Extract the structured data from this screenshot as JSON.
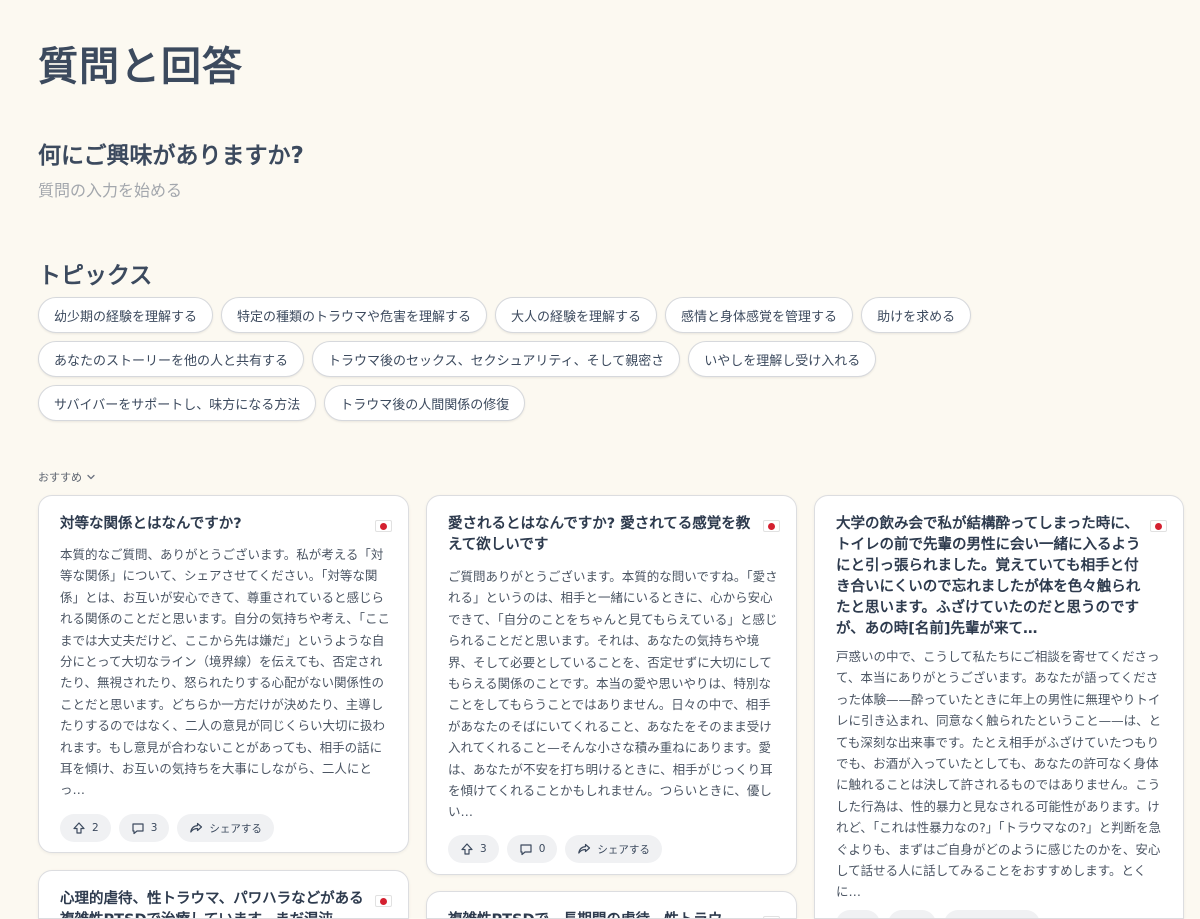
{
  "page_title": "質問と回答",
  "question": {
    "heading": "何にご興味がありますか?",
    "placeholder": "質問の入力を始める"
  },
  "topics": {
    "heading": "トピックス",
    "items": [
      "幼少期の経験を理解する",
      "特定の種類のトラウマや危害を理解する",
      "大人の経験を理解する",
      "感情と身体感覚を管理する",
      "助けを求める",
      "あなたのストーリーを他の人と共有する",
      "トラウマ後のセックス、セクシュアリティ、そして親密さ",
      "いやしを理解し受け入れる",
      "サバイバーをサポートし、味方になる方法",
      "トラウマ後の人間関係の修復"
    ]
  },
  "sort": {
    "label": "おすすめ"
  },
  "share_label": "シェアする",
  "cards": [
    {
      "title": "対等な関係とはなんですか?",
      "body": "本質的なご質問、ありがとうございます。私が考える「対等な関係」について、シェアさせてください。「対等な関係」とは、お互いが安心できて、尊重されていると感じられる関係のことだと思います。自分の気持ちや考え、「ここまでは大丈夫だけど、ここから先は嫌だ」というような自分にとって大切なライン（境界線）を伝えても、否定されたり、無視されたり、怒られたりする心配がない関係性のことだと思います。どちらか一方だけが決めたり、主導したりするのではなく、二人の意見が同じくらい大切に扱われます。もし意見が合わないことがあっても、相手の話に耳を傾け、お互いの気持ちを大事にしながら、二人にとっ…",
      "upvotes": "2",
      "comments": "3"
    },
    {
      "title": "愛されるとはなんですか? 愛されてる感覚を教えて欲しいです",
      "body": "ご質問ありがとうございます。本質的な問いですね。「愛される」というのは、相手と一緒にいるときに、心から安心できて、「自分のことをちゃんと見てもらえている」と感じられることだと思います。それは、あなたの気持ちや境界、そして必要としていることを、否定せずに大切にしてもらえる関係のことです。本当の愛や思いやりは、特別なことをしてもらうことではありません。日々の中で、相手があなたのそばにいてくれること、あなたをそのまま受け入れてくれること—そんな小さな積み重ねにあります。愛は、あなたが不安を打ち明けるときに、相手がじっくり耳を傾けてくれることかもしれません。つらいときに、優しい…",
      "upvotes": "3",
      "comments": "0"
    },
    {
      "title": "大学の飲み会で私が結構酔ってしまった時に、トイレの前で先輩の男性に会い一緒に入るようにと引っ張られました。覚えていても相手と付き合いにくいので忘れましたが体を色々触られたと思います。ふざけていたのだと思うのですが、あの時[名前]先輩が来て…",
      "body": "戸惑いの中で、こうして私たちにご相談を寄せてくださって、本当にありがとうございます。あなたが語ってくださった体験——酔っていたときに年上の男性に無理やりトイレに引き込まれ、同意なく触られたということ——は、とても深刻な出来事です。たとえ相手がふざけていたつもりでも、お酒が入っていたとしても、あなたの許可なく身体に触れることは決して許されるものではありません。こうした行為は、性的暴力と見なされる可能性があります。けれど、「これは性暴力なの?」「トラウマなの?」と判断を急ぐよりも、まずはご自身がどのように感じたのかを、安心して話せる人に話してみることをおすすめします。とくに…"
    },
    {
      "title": "心理的虐待、性トラウマ、パワハラなどがある複雑性PTSDで治療しています。まだ混沌"
    },
    {
      "title": "複雑性PTSDで、長期間の虐待、性トラウ"
    }
  ]
}
